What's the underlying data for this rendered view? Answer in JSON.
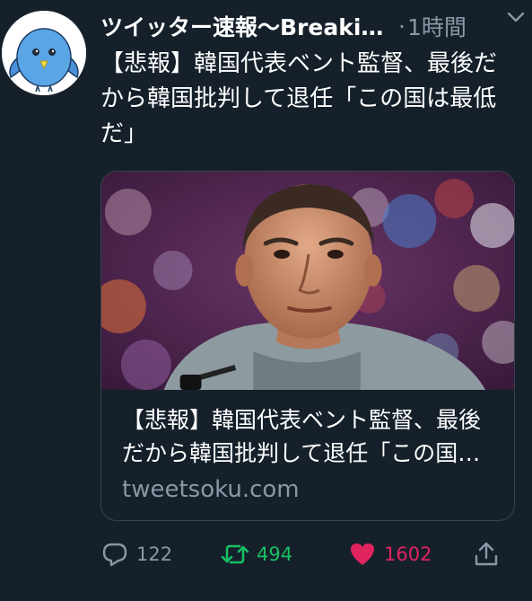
{
  "tweet": {
    "author": "ツイッター速報〜Breaking News",
    "separator": "·",
    "time": "1時間",
    "text": "【悲報】韓国代表ベント監督、最後だから韓国批判して退任「この国は最低だ」",
    "card": {
      "title": "【悲報】韓国代表ベント監督、最後だから韓国批判して退任「この国は最低だ」",
      "domain": "tweetsoku.com"
    },
    "stats": {
      "replies": "122",
      "retweets": "494",
      "likes": "1602"
    },
    "icons": {
      "avatar": "blue-bird-avatar",
      "menu": "chevron-down-icon",
      "reply": "reply-icon",
      "retweet": "retweet-icon",
      "like": "heart-icon",
      "share": "share-icon"
    }
  },
  "colors": {
    "background": "#15202b",
    "secondary_text": "#8899a6",
    "border": "#38444d",
    "retweet": "#17bf63",
    "like": "#e0245e"
  }
}
